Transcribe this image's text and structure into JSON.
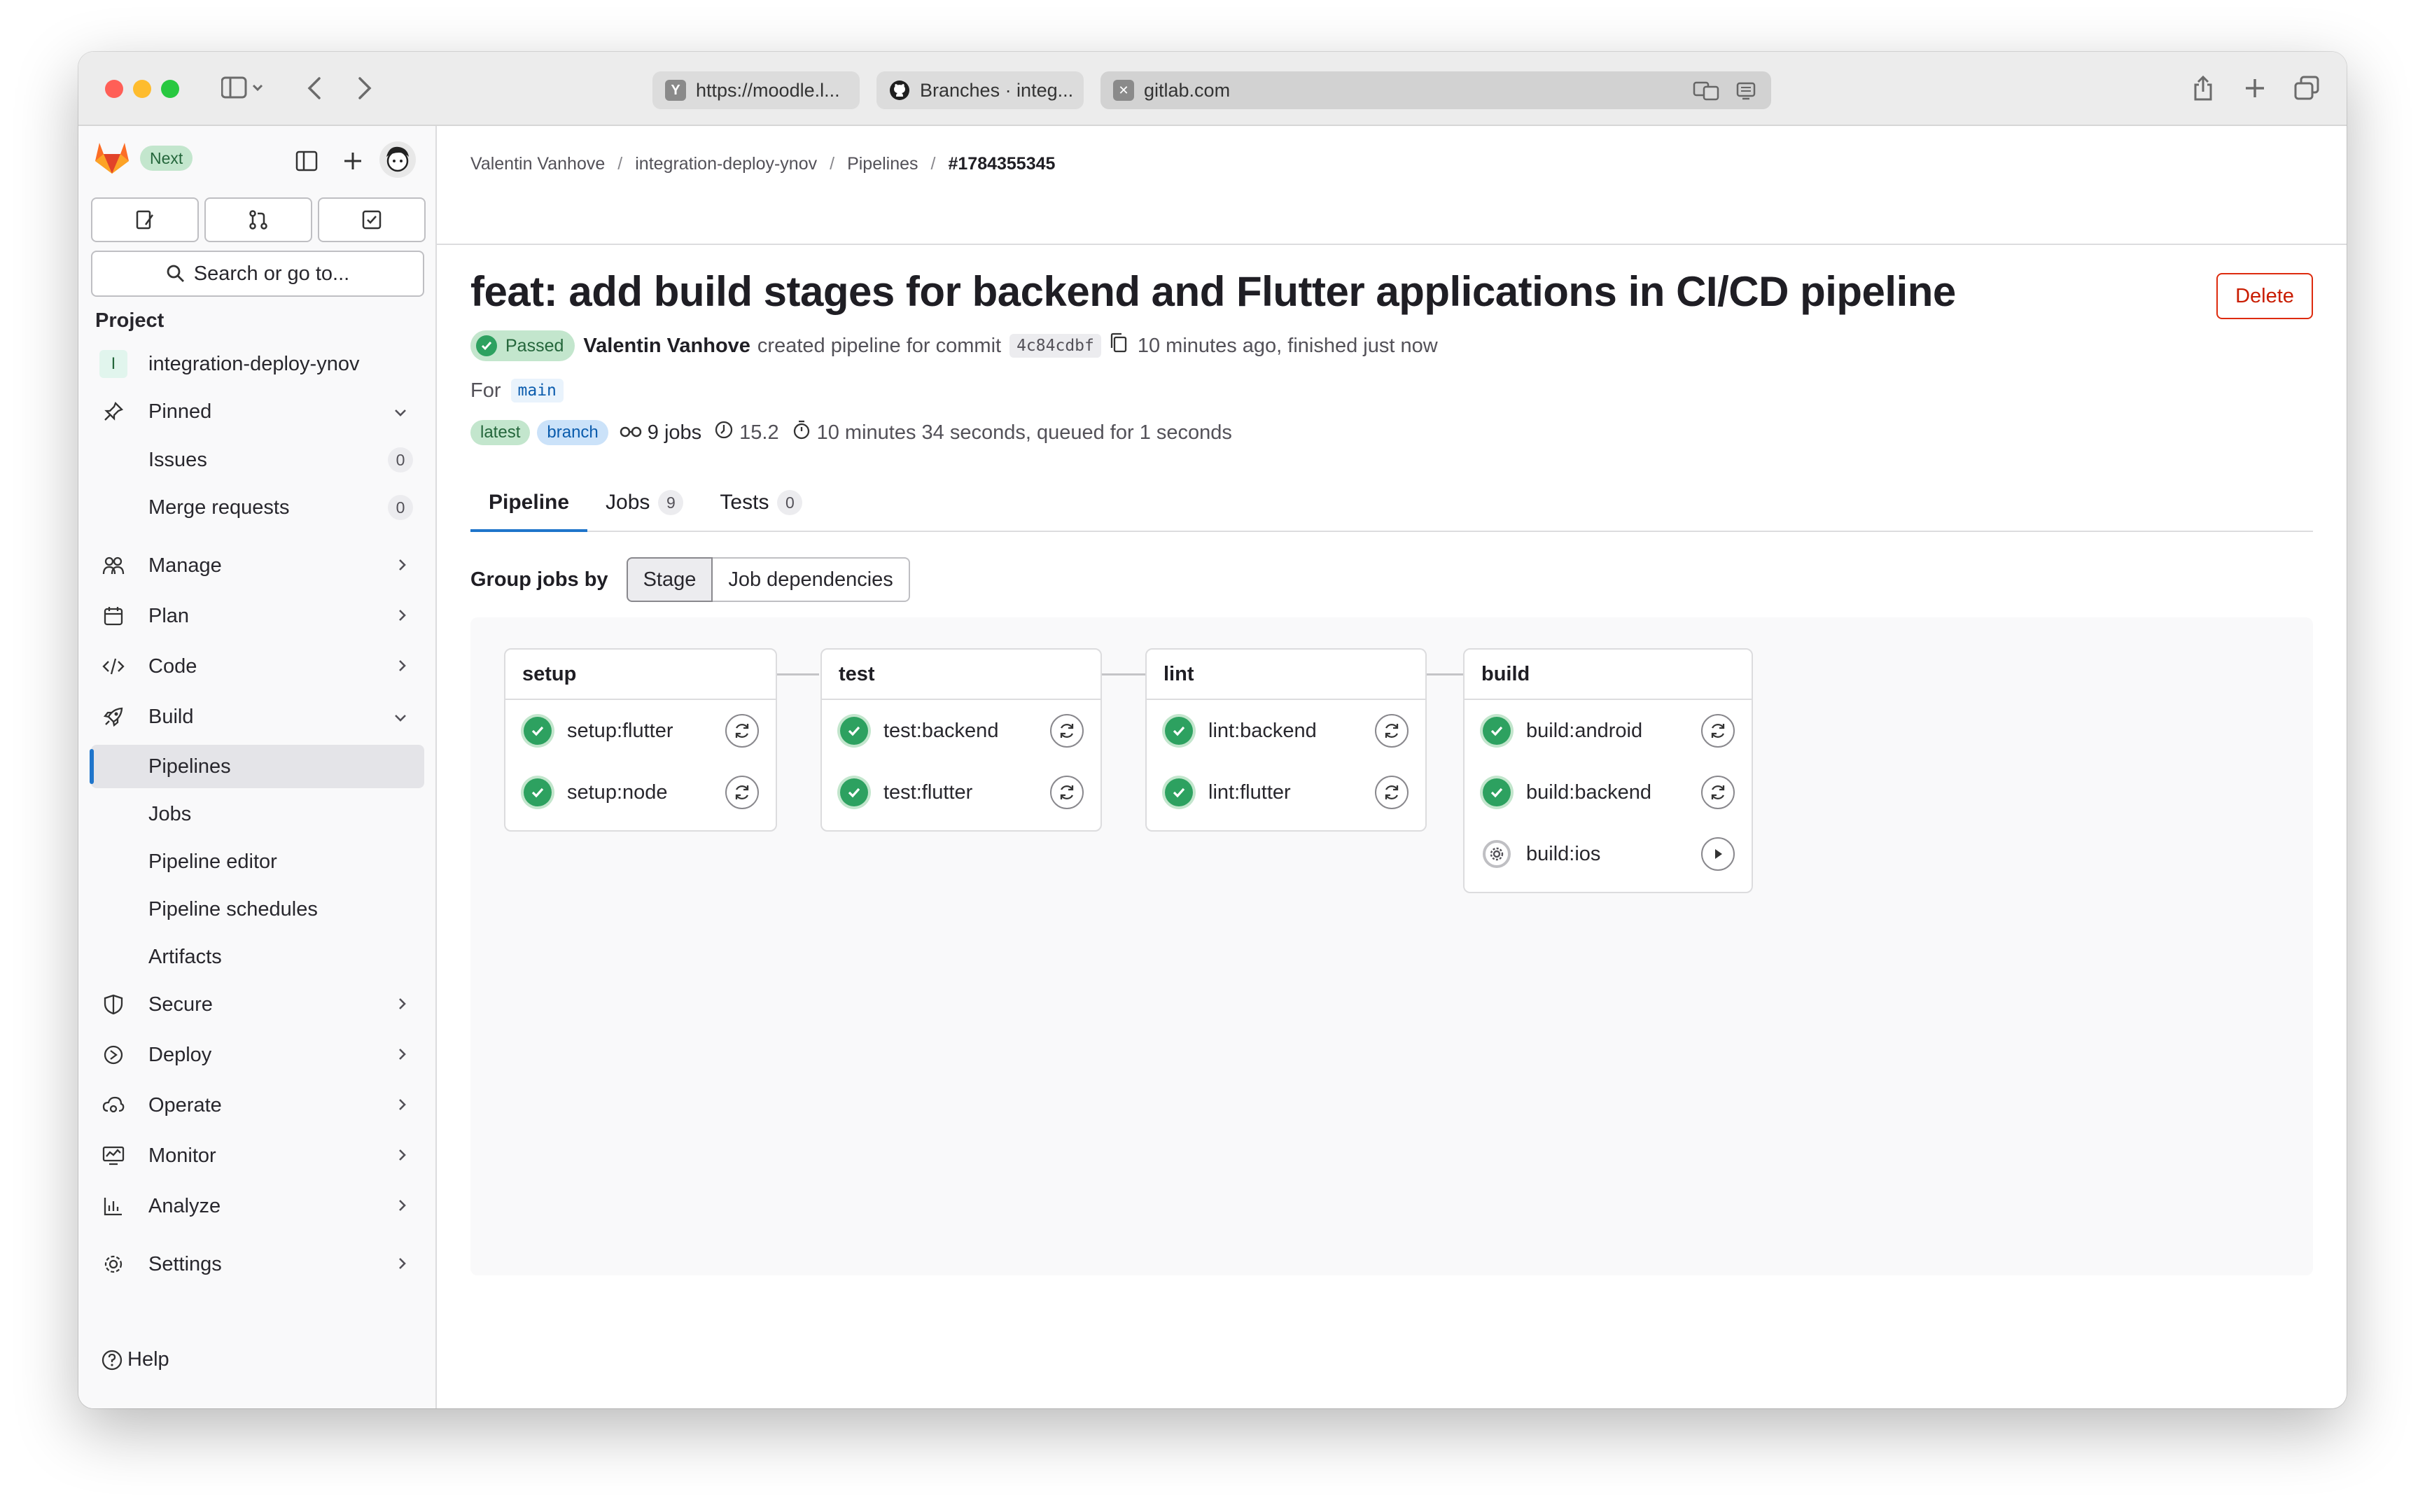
{
  "browser": {
    "tabs": [
      {
        "title": "https://moodle.l...",
        "favicon_letter": "Y"
      },
      {
        "title": "Branches · integ..."
      },
      {
        "title": "gitlab.com"
      }
    ]
  },
  "sidebar": {
    "badge": "Next",
    "search_label": "Search or go to...",
    "section_label": "Project",
    "project_initial": "I",
    "project_name": "integration-deploy-ynov",
    "pinned_label": "Pinned",
    "pinned_items": [
      {
        "label": "Issues",
        "count": "0"
      },
      {
        "label": "Merge requests",
        "count": "0"
      }
    ],
    "nav": {
      "manage": "Manage",
      "plan": "Plan",
      "code": "Code",
      "build": "Build",
      "secure": "Secure",
      "deploy": "Deploy",
      "operate": "Operate",
      "monitor": "Monitor",
      "analyze": "Analyze",
      "settings": "Settings"
    },
    "build_items": [
      "Pipelines",
      "Jobs",
      "Pipeline editor",
      "Pipeline schedules",
      "Artifacts"
    ],
    "help_label": "Help"
  },
  "breadcrumb": [
    "Valentin Vanhove",
    "integration-deploy-ynov",
    "Pipelines",
    "#1784355345"
  ],
  "pipeline": {
    "title": "feat: add build stages for backend and Flutter applications in CI/CD pipeline",
    "delete_label": "Delete",
    "status": "Passed",
    "author": "Valentin Vanhove",
    "created_text": "created pipeline for commit",
    "commit_sha": "4c84cdbf",
    "time_text": "10 minutes ago, finished just now",
    "for_label": "For",
    "ref": "main",
    "tags": [
      "latest",
      "branch"
    ],
    "jobs_count": "9 jobs",
    "compute": "15.2",
    "duration": "10 minutes 34 seconds, queued for 1 seconds"
  },
  "tabs": [
    {
      "label": "Pipeline"
    },
    {
      "label": "Jobs",
      "count": "9"
    },
    {
      "label": "Tests",
      "count": "0"
    }
  ],
  "group_by": {
    "label": "Group jobs by",
    "options": [
      "Stage",
      "Job dependencies"
    ],
    "selected": "Stage"
  },
  "stages": [
    {
      "name": "setup",
      "jobs": [
        {
          "name": "setup:flutter",
          "status": "passed",
          "action": "retry"
        },
        {
          "name": "setup:node",
          "status": "passed",
          "action": "retry"
        }
      ]
    },
    {
      "name": "test",
      "jobs": [
        {
          "name": "test:backend",
          "status": "passed",
          "action": "retry"
        },
        {
          "name": "test:flutter",
          "status": "passed",
          "action": "retry"
        }
      ]
    },
    {
      "name": "lint",
      "jobs": [
        {
          "name": "lint:backend",
          "status": "passed",
          "action": "retry"
        },
        {
          "name": "lint:flutter",
          "status": "passed",
          "action": "retry"
        }
      ]
    },
    {
      "name": "build",
      "jobs": [
        {
          "name": "build:android",
          "status": "passed",
          "action": "retry"
        },
        {
          "name": "build:backend",
          "status": "passed",
          "action": "retry"
        },
        {
          "name": "build:ios",
          "status": "manual",
          "action": "play"
        }
      ]
    }
  ],
  "colors": {
    "accent": "#1f75cb",
    "success": "#2da160",
    "danger": "#dd2b0e",
    "gitlab_orange": "#fc6d26"
  }
}
